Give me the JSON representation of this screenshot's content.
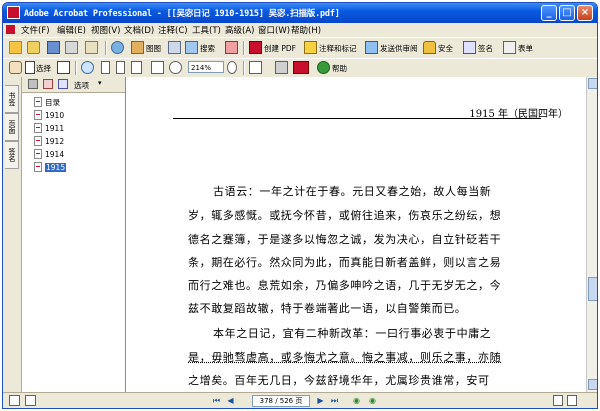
{
  "window": {
    "title": "Adobe Acrobat Professional - [[吴宓日记 1910-1915] 吴宓.扫描版.pdf]",
    "min_symbol": "_",
    "max_symbol": "□",
    "close_symbol": "×"
  },
  "menu": [
    "文件(F)",
    "编辑(E)",
    "视图(V)",
    "文档(D)",
    "注释(C)",
    "工具(T)",
    "高级(A)",
    "窗口(W)",
    "帮助(H)"
  ],
  "toolbar1": {
    "organizer_label": "图图",
    "search_label": "搜索",
    "create_pdf_label": "创建 PDF",
    "comment_label": "注释和标记",
    "send_review_label": "发送供审阅",
    "secure_label": "安全",
    "sign_label": "签名",
    "forms_label": "表单"
  },
  "toolbar2": {
    "select_label": "选择",
    "zoom_value": "214%",
    "help_label": "帮助"
  },
  "bookmarks": {
    "options_label": "选项",
    "items": [
      {
        "label": "目录"
      },
      {
        "label": "1910"
      },
      {
        "label": "1911"
      },
      {
        "label": "1912"
      },
      {
        "label": "1914"
      },
      {
        "label": "1915"
      }
    ]
  },
  "left_tabs": [
    "书签",
    "页面",
    "签名"
  ],
  "document": {
    "header": "1915 年（民国四年）",
    "lines": [
      "古语云：一年之计在于春。元日又春之始，故人每当新",
      "岁，辄多感慨。或抚今怀昔，或俯往追来，伤哀乐之纷纭，想",
      "德名之蹇簿，于是遂多以悔忽之诚，发为决心，自立针砭若干",
      "条，期在必行。然众同为此，而真能日新者盖鲜，则以言之易",
      "而行之难也。息荒如余，乃偏多呻吟之语，几于无岁无之，今",
      "兹不敢复蹈故辙，特于卷端著此一语，以自警策而已。",
      "本年之日记，宜有二种新改革：一曰行事必衷于中庸之",
      "是，毋驰骛虚高，或多悔尤之意。悔之事减，则乐之事，亦随",
      "之增矣。百年无几日，今兹舒境华年，尤属珍贵谁常，安可"
    ]
  },
  "status": {
    "page_display": "378 / 526 页"
  },
  "colors": {
    "title_bar": "#0a5ae0",
    "chrome": "#ece9d8",
    "accent_red": "#c8102e"
  }
}
